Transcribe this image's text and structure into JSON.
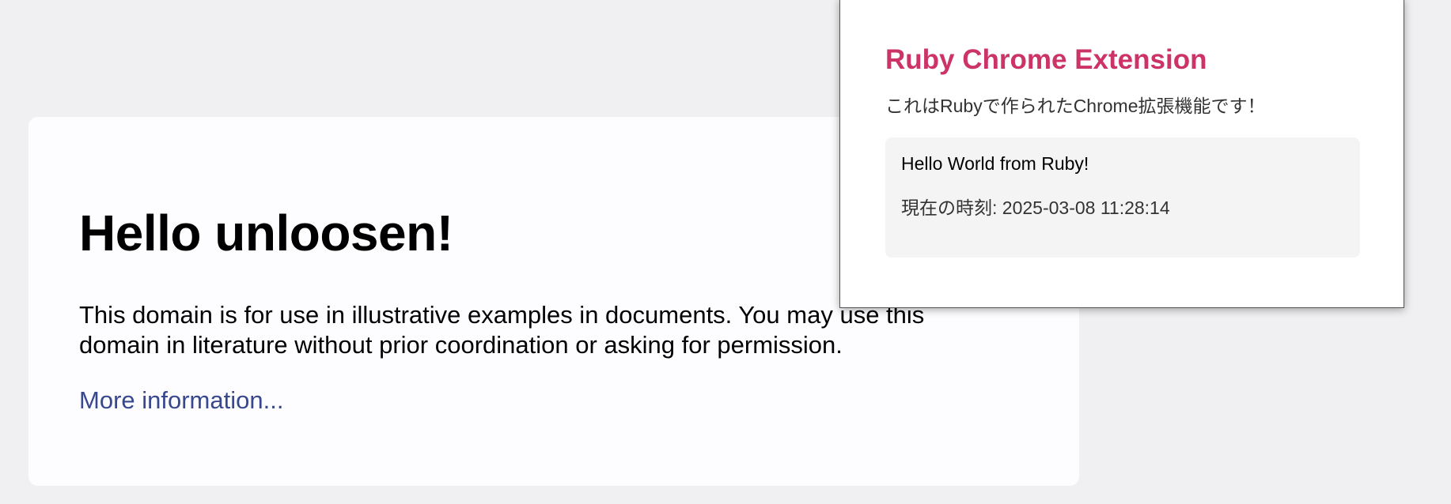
{
  "page": {
    "heading": "Hello unloosen!",
    "paragraph": "This domain is for use in illustrative examples in documents. You may use this domain in literature without prior coordination or asking for permission.",
    "more_info_link": "More information..."
  },
  "extension_popup": {
    "title": "Ruby Chrome Extension",
    "description": "これはRubyで作られたChrome拡張機能です！",
    "output": {
      "hello": "Hello World from Ruby!",
      "time_label": "現在の時刻: 2025-03-08 11:28:14"
    }
  },
  "colors": {
    "background": "#f0f0f2",
    "card": "#fdfdff",
    "link": "#38488f",
    "popup_title": "#cc3366",
    "output_box": "#f4f4f4"
  }
}
